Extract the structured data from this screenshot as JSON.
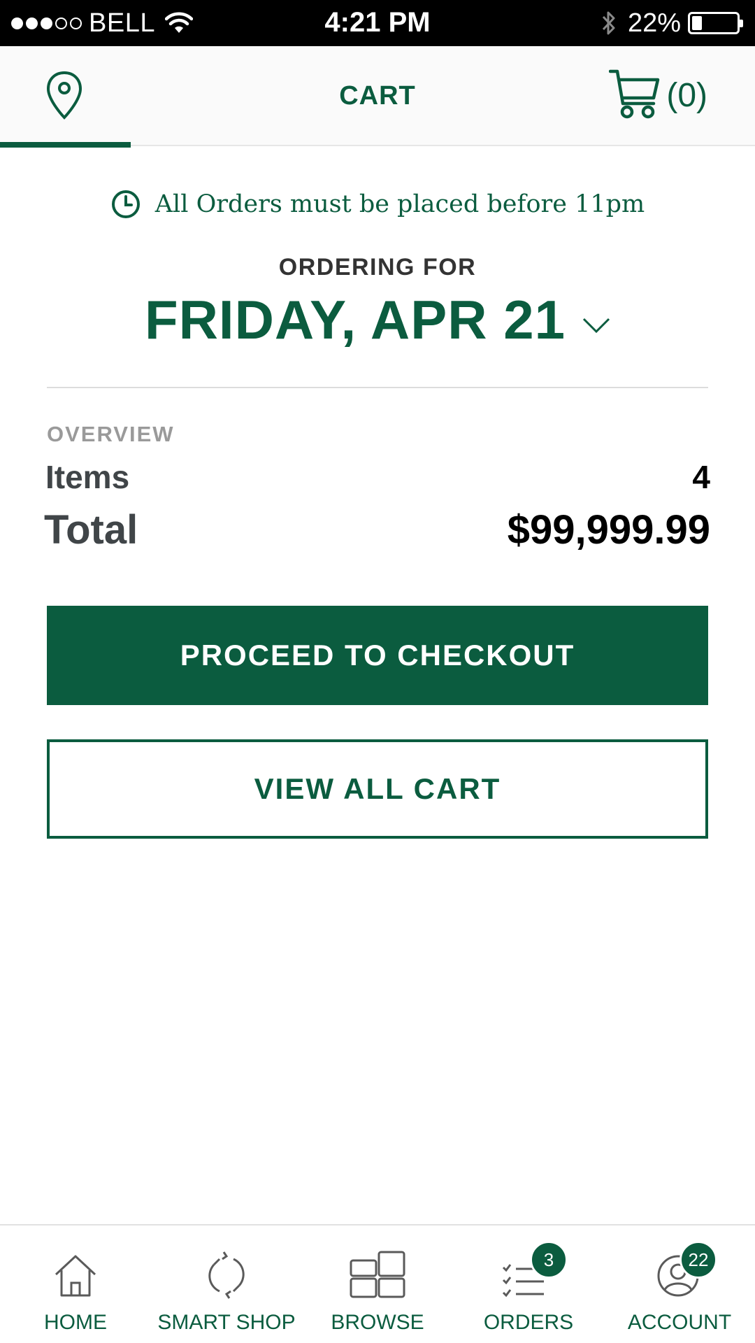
{
  "status_bar": {
    "carrier": "BELL",
    "signal_dots": [
      true,
      true,
      true,
      false,
      false
    ],
    "time": "4:21 PM",
    "battery_percent": "22%",
    "battery_level": 0.22
  },
  "header": {
    "title": "CART",
    "cart_count": "(0)"
  },
  "notice": {
    "text": "All Orders must be placed before 11pm"
  },
  "ordering": {
    "label": "ORDERING FOR",
    "date": "FRIDAY, APR 21"
  },
  "overview": {
    "label": "OVERVIEW",
    "items_label": "Items",
    "items_value": "4",
    "total_label": "Total",
    "total_value": "$99,999.99"
  },
  "buttons": {
    "checkout": "PROCEED TO CHECKOUT",
    "view_all": "VIEW ALL CART"
  },
  "bottom_nav": {
    "items": [
      {
        "label": "HOME",
        "icon": "home-icon"
      },
      {
        "label": "SMART SHOP",
        "icon": "refresh-icon"
      },
      {
        "label": "BROWSE",
        "icon": "grid-icon"
      },
      {
        "label": "ORDERS",
        "icon": "checklist-icon",
        "badge": "3"
      },
      {
        "label": "ACCOUNT",
        "icon": "user-icon",
        "badge": "22"
      }
    ]
  },
  "colors": {
    "brand_green": "#0b5c3f",
    "text_gray": "#404548"
  }
}
